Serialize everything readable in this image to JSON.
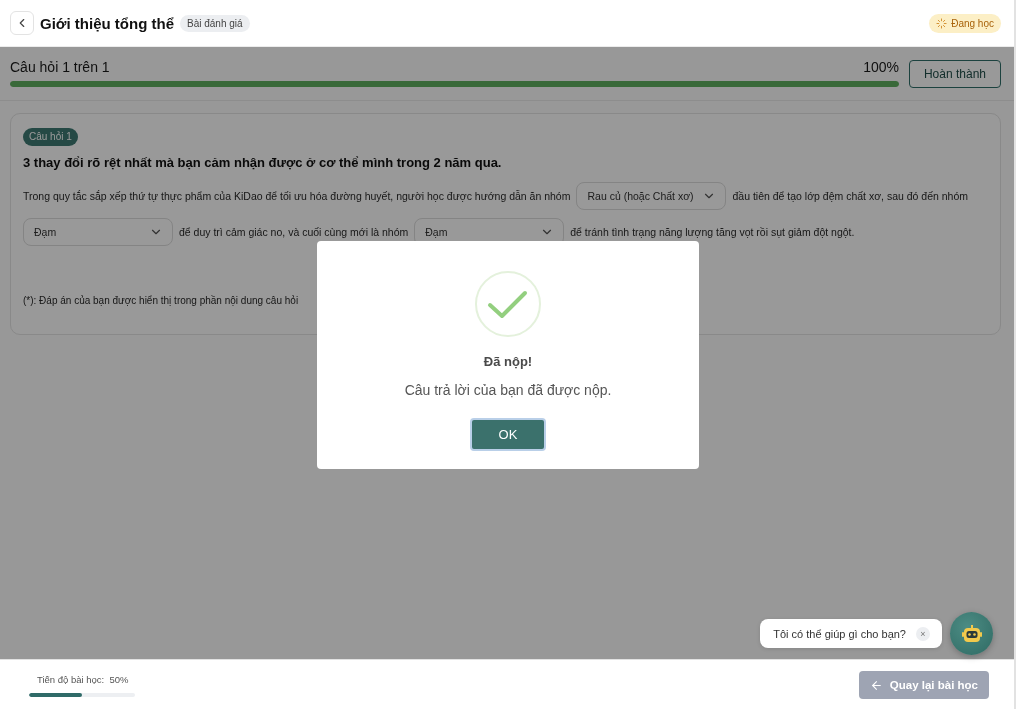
{
  "header": {
    "title": "Giới thiệu tổng thể",
    "badge": "Bài đánh giá",
    "status": "Đang học"
  },
  "progress": {
    "label": "Câu hỏi 1 trên 1",
    "percent": "100%",
    "level": 1,
    "finish_button": "Hoàn thành"
  },
  "question": {
    "tag": "Câu hỏi 1",
    "title": "3 thay đổi rõ rệt nhất mà bạn cảm nhận được ở cơ thể mình trong 2 năm qua.",
    "content": [
      {
        "kind": "text",
        "text": "Trong quy tắc sắp xếp thứ tự thực phẩm của KiDao để tối ưu hóa đường huyết, người học được hướng dẫn ăn nhóm"
      },
      {
        "kind": "select",
        "value": "Rau củ (hoặc Chất xơ)"
      },
      {
        "kind": "text",
        "text": "đầu tiên để tạo lớp đệm chất xơ, sau đó đến nhóm"
      },
      {
        "kind": "select",
        "value": "Đạm"
      },
      {
        "kind": "text",
        "text": "để duy trì cảm giác no, và cuối cùng mới là nhóm"
      },
      {
        "kind": "select",
        "value": "Đạm"
      },
      {
        "kind": "text",
        "text": "để tránh tình trạng năng lượng tăng vọt rồi sụt giảm đột ngột."
      }
    ],
    "footnote": "(*): Đáp án của bạn được hiển thị trong phần nội dung câu hỏi"
  },
  "modal": {
    "title": "Đã nộp!",
    "message": "Câu trả lời của bạn đã được nộp.",
    "button": "OK"
  },
  "chat": {
    "message": "Tôi có thể giúp gì cho bạn?",
    "close": "×"
  },
  "footer": {
    "progress_label": "Tiến độ bài học:  50%",
    "level": 0.5,
    "back_button": "Quay lại bài học",
    "back_disabled": true
  }
}
